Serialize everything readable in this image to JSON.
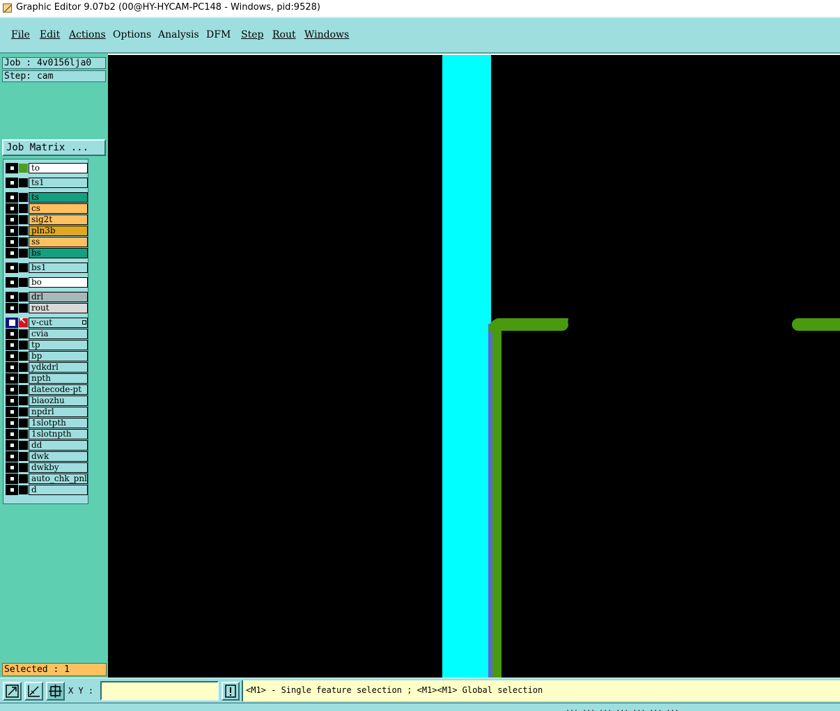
{
  "window": {
    "title": "Graphic Editor 9.07b2 (00@HY-HYCAM-PC148 - Windows, pid:9528)",
    "icon": "graphic-editor-app-icon"
  },
  "menu": {
    "items": [
      {
        "label": "File",
        "underlined": true
      },
      {
        "label": "Edit",
        "underlined": true
      },
      {
        "label": "Actions",
        "underlined": true
      },
      {
        "label": "Options",
        "underlined": false
      },
      {
        "label": "Analysis",
        "underlined": false
      },
      {
        "label": "DFM",
        "underlined": false
      },
      {
        "label": "Step",
        "underlined": true
      },
      {
        "label": "Rout",
        "underlined": true
      },
      {
        "label": "Windows",
        "underlined": true
      }
    ]
  },
  "panel": {
    "job": "Job : 4v0156lja0",
    "step": "Step: cam",
    "job_matrix_button": "Job Matrix ...",
    "layers": [
      {
        "name": "to",
        "color": "#ffffff",
        "swatch": "#4aa020"
      },
      {
        "name": "ts1",
        "color": "#9fdedf",
        "swatch": "#000000"
      },
      {
        "name": "ts",
        "color": "#13a080",
        "swatch": "#000000"
      },
      {
        "name": "cs",
        "color": "#ffc060",
        "swatch": "#000000"
      },
      {
        "name": "sig2t",
        "color": "#ffc060",
        "swatch": "#000000"
      },
      {
        "name": "pln3b",
        "color": "#e0a820",
        "swatch": "#000000"
      },
      {
        "name": "ss",
        "color": "#ffc060",
        "swatch": "#000000"
      },
      {
        "name": "bs",
        "color": "#13a080",
        "swatch": "#000000"
      },
      {
        "name": "bs1",
        "color": "#9fdedf",
        "swatch": "#000000"
      },
      {
        "name": "bo",
        "color": "#ffffff",
        "swatch": "#000000"
      },
      {
        "name": "drl",
        "color": "#a8b8b8",
        "swatch": "#000000"
      },
      {
        "name": "rout",
        "color": "#d8d8d8",
        "swatch": "#000000"
      },
      {
        "name": "v-cut",
        "color": "#9fdedf",
        "swatch": "#e0101a",
        "active": true,
        "arrow_icon": "work-layer-arrow-icon"
      },
      {
        "name": "cvia",
        "color": "#9fdedf",
        "swatch": "#000000"
      },
      {
        "name": "tp",
        "color": "#9fdedf",
        "swatch": "#000000"
      },
      {
        "name": "bp",
        "color": "#9fdedf",
        "swatch": "#000000"
      },
      {
        "name": "ydkdrl",
        "color": "#9fdedf",
        "swatch": "#000000"
      },
      {
        "name": "npth",
        "color": "#9fdedf",
        "swatch": "#000000"
      },
      {
        "name": "datecode-pt",
        "color": "#9fdedf",
        "swatch": "#000000"
      },
      {
        "name": "biaozhu",
        "color": "#9fdedf",
        "swatch": "#000000"
      },
      {
        "name": "npdrl",
        "color": "#9fdedf",
        "swatch": "#000000"
      },
      {
        "name": "1slotpth",
        "color": "#9fdedf",
        "swatch": "#000000"
      },
      {
        "name": "1slotnpth",
        "color": "#9fdedf",
        "swatch": "#000000"
      },
      {
        "name": "dd",
        "color": "#9fdedf",
        "swatch": "#000000"
      },
      {
        "name": "dwk",
        "color": "#9fdedf",
        "swatch": "#000000"
      },
      {
        "name": "dwkby",
        "color": "#9fdedf",
        "swatch": "#000000"
      },
      {
        "name": "auto_chk_pnl",
        "color": "#9fdedf",
        "swatch": "#000000"
      },
      {
        "name": "d",
        "color": "#9fdedf",
        "swatch": "#000000"
      }
    ],
    "selected": "Selected : 1"
  },
  "canvas": {
    "background": "#000000",
    "colors": {
      "vcut_band": "#00ffff",
      "outline": "#4a9a10",
      "edge": "#5a6ad0"
    }
  },
  "toolbar": {
    "icons": [
      "zoom-box-icon",
      "measure-icon",
      "snap-grid-icon",
      "warning-icon"
    ],
    "xy_label": "X Y :",
    "xy_value": "",
    "hint": "<M1> - Single feature selection ; <M1><M1> Global selection"
  },
  "status": {
    "text": "... ... ... ... ... ... ..."
  }
}
